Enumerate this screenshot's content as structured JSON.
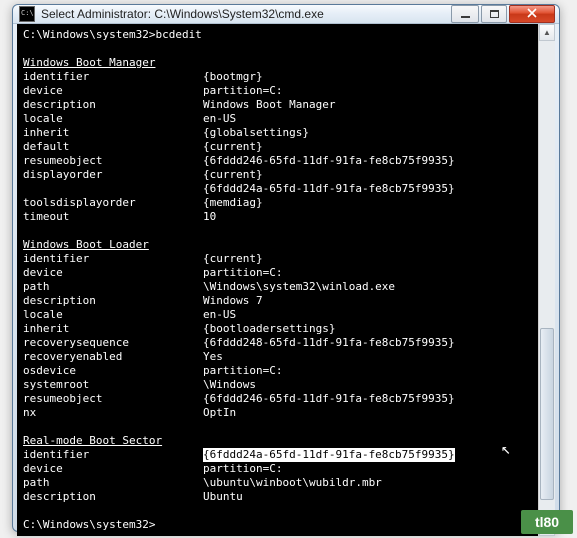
{
  "window": {
    "title": "Select Administrator: C:\\Windows\\System32\\cmd.exe"
  },
  "prompt": {
    "line1": "C:\\Windows\\system32>bcdedit",
    "final": "C:\\Windows\\system32>"
  },
  "sections": {
    "bootmgr": {
      "title": "Windows Boot Manager",
      "rows": [
        {
          "k": "identifier",
          "v": "{bootmgr}"
        },
        {
          "k": "device",
          "v": "partition=C:"
        },
        {
          "k": "description",
          "v": "Windows Boot Manager"
        },
        {
          "k": "locale",
          "v": "en-US"
        },
        {
          "k": "inherit",
          "v": "{globalsettings}"
        },
        {
          "k": "default",
          "v": "{current}"
        },
        {
          "k": "resumeobject",
          "v": "{6fddd246-65fd-11df-91fa-fe8cb75f9935}"
        },
        {
          "k": "displayorder",
          "v": "{current}"
        },
        {
          "k": "",
          "v": "{6fddd24a-65fd-11df-91fa-fe8cb75f9935}"
        },
        {
          "k": "toolsdisplayorder",
          "v": "{memdiag}"
        },
        {
          "k": "timeout",
          "v": "10"
        }
      ]
    },
    "loader": {
      "title": "Windows Boot Loader",
      "rows": [
        {
          "k": "identifier",
          "v": "{current}"
        },
        {
          "k": "device",
          "v": "partition=C:"
        },
        {
          "k": "path",
          "v": "\\Windows\\system32\\winload.exe"
        },
        {
          "k": "description",
          "v": "Windows 7"
        },
        {
          "k": "locale",
          "v": "en-US"
        },
        {
          "k": "inherit",
          "v": "{bootloadersettings}"
        },
        {
          "k": "recoverysequence",
          "v": "{6fddd248-65fd-11df-91fa-fe8cb75f9935}"
        },
        {
          "k": "recoveryenabled",
          "v": "Yes"
        },
        {
          "k": "osdevice",
          "v": "partition=C:"
        },
        {
          "k": "systemroot",
          "v": "\\Windows"
        },
        {
          "k": "resumeobject",
          "v": "{6fddd246-65fd-11df-91fa-fe8cb75f9935}"
        },
        {
          "k": "nx",
          "v": "OptIn"
        }
      ]
    },
    "realmode": {
      "title": "Real-mode Boot Sector",
      "rows": [
        {
          "k": "identifier",
          "v": "{6fddd24a-65fd-11df-91fa-fe8cb75f9935}",
          "selected": true
        },
        {
          "k": "device",
          "v": "partition=C:"
        },
        {
          "k": "path",
          "v": "\\ubuntu\\winboot\\wubildr.mbr"
        },
        {
          "k": "description",
          "v": "Ubuntu"
        }
      ]
    }
  },
  "watermark": "tl80"
}
